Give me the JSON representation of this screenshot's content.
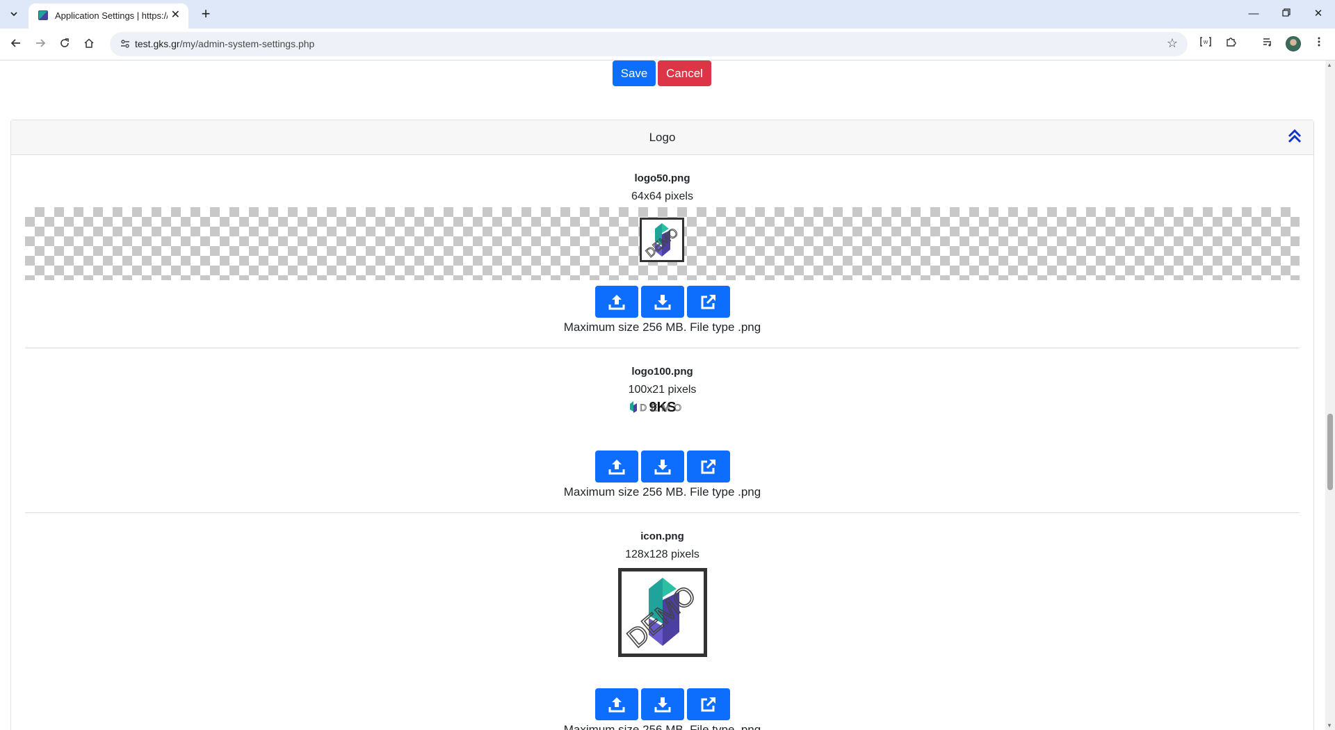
{
  "browser": {
    "tab_title": "Application Settings | https://test.gks.gr",
    "url_host": "test.gks.gr",
    "url_path": "/my/admin-system-settings.php"
  },
  "form_actions": {
    "save_label": "Save",
    "cancel_label": "Cancel"
  },
  "section": {
    "title": "Logo",
    "collapse_icon": "double-chevron-up-icon",
    "files": [
      {
        "name": "logo50.png",
        "dimensions": "64x64 pixels",
        "help": "Maximum size 256 MB. File type .png",
        "transparent_preview": true
      },
      {
        "name": "logo100.png",
        "dimensions": "100x21 pixels",
        "help": "Maximum size 256 MB. File type .png",
        "transparent_preview": false
      },
      {
        "name": "icon.png",
        "dimensions": "128x128 pixels",
        "help": "Maximum size 256 MB. File type .png",
        "transparent_preview": false
      }
    ],
    "action_icons": [
      "upload-icon",
      "download-icon",
      "external-link-icon"
    ],
    "logo_overlay_text": "DEMO",
    "wordmark_text": "9KS"
  },
  "colors": {
    "primary": "#0d6efd",
    "danger": "#dc3545",
    "tab_bar": "#dee8f8"
  }
}
